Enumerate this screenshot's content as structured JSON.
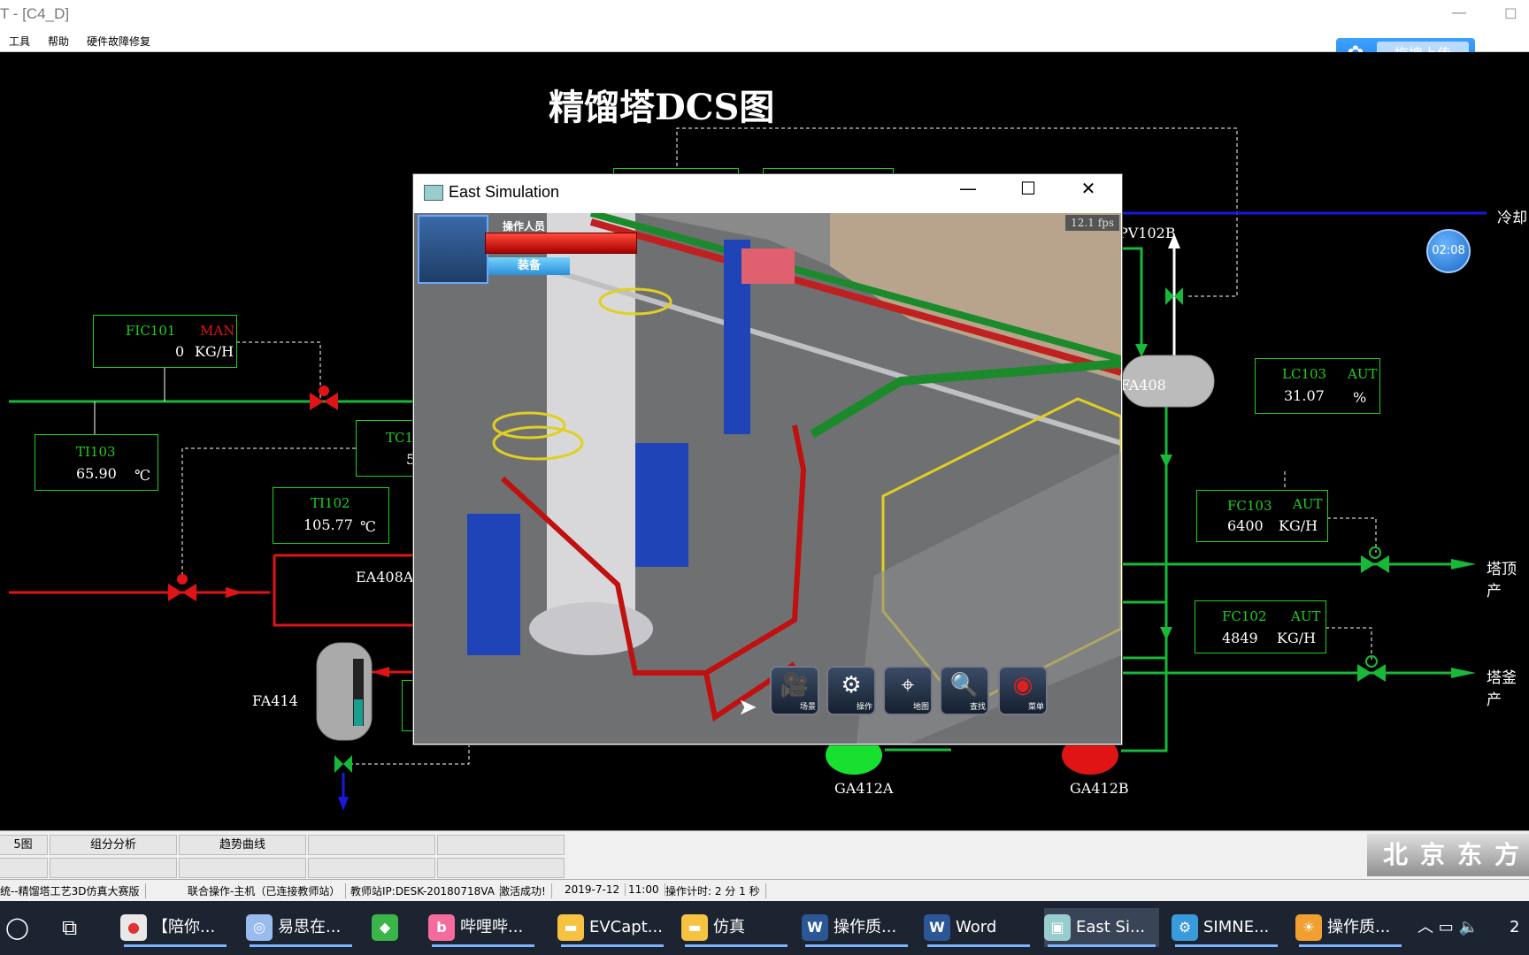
{
  "window": {
    "title": "T - [C4_D]",
    "min": "—",
    "max": "◻"
  },
  "menu": [
    "工具",
    "帮助",
    "硬件故障修复"
  ],
  "upload": {
    "label": "拖拽上传"
  },
  "dcs": {
    "title": "精馏塔DCS图",
    "timer": "02:08",
    "fic101": {
      "tag": "FIC101",
      "mode": "MAN",
      "value": "0",
      "unit": "KG/H"
    },
    "ti103": {
      "tag": "TI103",
      "value": "65.90",
      "unit": "℃"
    },
    "ti102": {
      "tag": "TI102",
      "value": "105.77",
      "unit": "℃"
    },
    "tc_partial": {
      "tag": "TC1",
      "value": "5"
    },
    "lc103": {
      "tag": "LC103",
      "mode": "AUT",
      "value": "31.07",
      "unit": "%"
    },
    "fc103": {
      "tag": "FC103",
      "mode": "AUT",
      "value": "6400",
      "unit": "KG/H"
    },
    "fc102": {
      "tag": "FC102",
      "mode": "AUT",
      "value": "4849",
      "unit": "KG/H"
    },
    "labels": {
      "ea408a": "EA408A",
      "fa414": "FA414",
      "fa408": "FA408",
      "pv102b": "PV102B",
      "ga412a": "GA412A",
      "ga412b": "GA412B",
      "lengque": "冷却",
      "tading": "塔顶产",
      "tafu": "塔釜产"
    }
  },
  "sim": {
    "title": "East Simulation",
    "fps": "12.1 fps",
    "operator": "操作人员",
    "equip": "装备",
    "buttons": [
      {
        "icon": "camera-icon",
        "glyph": "🎥",
        "cap": "场景"
      },
      {
        "icon": "gear-icon",
        "glyph": "⚙",
        "cap": "操作"
      },
      {
        "icon": "map-pin-icon",
        "glyph": "⌖",
        "cap": "地图"
      },
      {
        "icon": "search-icon",
        "glyph": "🔍",
        "cap": "查找"
      },
      {
        "icon": "menu-icon",
        "glyph": "◉",
        "cap": "菜单"
      }
    ]
  },
  "tabs": {
    "t1": "5图",
    "t2": "组分分析",
    "t3": "趋势曲线"
  },
  "brand": "北京东方",
  "status": [
    "统--精馏塔工艺3D仿真大赛版",
    "联合操作-主机（已连接教师站）",
    "教师站IP:DESK-20180718VA",
    "激活成功!",
    "2019-7-12",
    "11:00",
    "操作计时: 2 分 1 秒"
  ],
  "taskbar": [
    {
      "label": "【陪你...",
      "color": "#e8e8e8"
    },
    {
      "label": "易思在...",
      "color": "#9be"
    },
    {
      "label": "",
      "color": "#3bb54a"
    },
    {
      "label": "哔哩哔...",
      "color": "#f56b9d"
    },
    {
      "label": "EVCapt...",
      "color": "#f5c242"
    },
    {
      "label": "仿真",
      "color": "#f5c242"
    },
    {
      "label": "操作质...",
      "color": "#2b5797"
    },
    {
      "label": "Word",
      "color": "#2b5797"
    },
    {
      "label": "East Si...",
      "color": "#9cc"
    },
    {
      "label": "SIMNE...",
      "color": "#3a9bdc"
    },
    {
      "label": "操作质...",
      "color": "#f0a030"
    }
  ],
  "tray": {
    "time": "2"
  }
}
